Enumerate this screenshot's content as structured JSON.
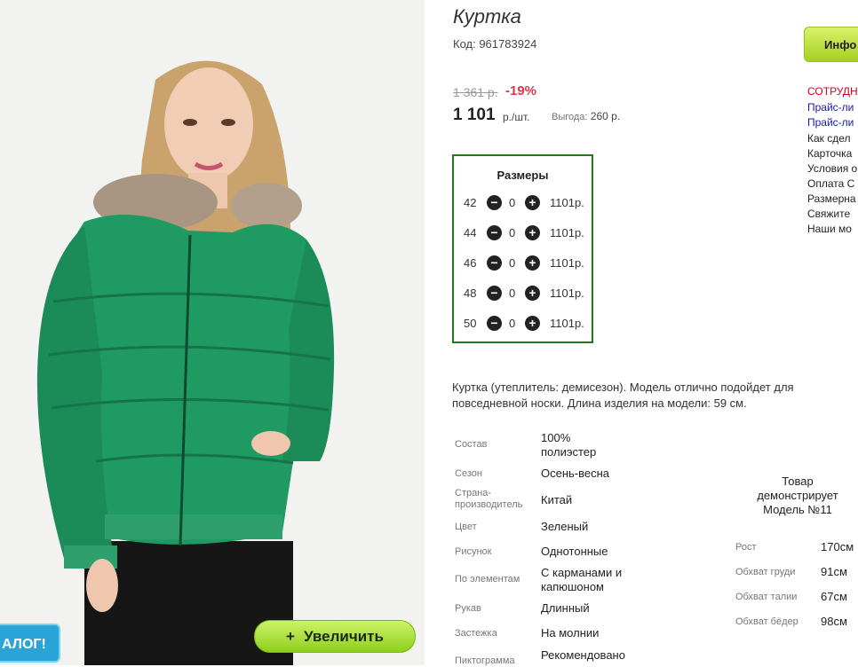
{
  "product": {
    "title": "Куртка",
    "code": "Код: 961783924",
    "old_price": "1 361 р.",
    "discount": "-19%",
    "price": "1 101",
    "unit": "р./шт.",
    "benefit_label": "Выгода:",
    "benefit_value": "260 р."
  },
  "sizes": {
    "header": "Размеры",
    "rows": [
      {
        "size": "42",
        "qty": "0",
        "price": "1101р."
      },
      {
        "size": "44",
        "qty": "0",
        "price": "1101р."
      },
      {
        "size": "46",
        "qty": "0",
        "price": "1101р."
      },
      {
        "size": "48",
        "qty": "0",
        "price": "1101р."
      },
      {
        "size": "50",
        "qty": "0",
        "price": "1101р."
      }
    ]
  },
  "description": "Куртка (утеплитель: демисезон). Модель отлично подойдет для повседневной носки. Длина изделия на модели: 59 см.",
  "properties": [
    {
      "label": "Состав",
      "value": "100% полиэстер"
    },
    {
      "label": "Сезон",
      "value": "Осень-весна"
    },
    {
      "label": "Страна-производитель",
      "value": "Китай"
    },
    {
      "label": "Цвет",
      "value": "Зеленый"
    },
    {
      "label": "Рисунок",
      "value": "Однотонные"
    },
    {
      "label": "По элементам",
      "value": "С карманами и капюшоном"
    },
    {
      "label": "Рукав",
      "value": "Длинный"
    },
    {
      "label": "Застежка",
      "value": "На молнии"
    },
    {
      "label": "Пиктограмма",
      "value": "Рекомендовано"
    }
  ],
  "sidebar": {
    "info_button": "Инфо",
    "links": [
      {
        "text": "СОТРУДН",
        "color": "#d0021b"
      },
      {
        "text": "Прайс-ли",
        "color": "#1a1aa6"
      },
      {
        "text": "Прайс-ли",
        "color": "#1a1aa6"
      },
      {
        "text": "Как сдел",
        "color": "#222222"
      },
      {
        "text": "Карточка",
        "color": "#222222"
      },
      {
        "text": "Условия о",
        "color": "#222222"
      },
      {
        "text": "Оплата С",
        "color": "#222222"
      },
      {
        "text": "Размерна",
        "color": "#222222"
      },
      {
        "text": "Свяжите",
        "color": "#222222"
      },
      {
        "text": "Наши мо",
        "color": "#222222"
      }
    ]
  },
  "model": {
    "caption": "Товар демонстрирует Модель №11",
    "measurements": [
      {
        "label": "Рост",
        "value": "170см"
      },
      {
        "label": "Обхват груди",
        "value": "91см"
      },
      {
        "label": "Обхват талии",
        "value": "67см"
      },
      {
        "label": "Обхват бёдер",
        "value": "98см"
      }
    ]
  },
  "photo": {
    "zoom_button": "Увеличить",
    "catalog_badge": "АЛОГ!",
    "jacket_color": "#1f9a63",
    "accent_green": "#1f7a18"
  }
}
